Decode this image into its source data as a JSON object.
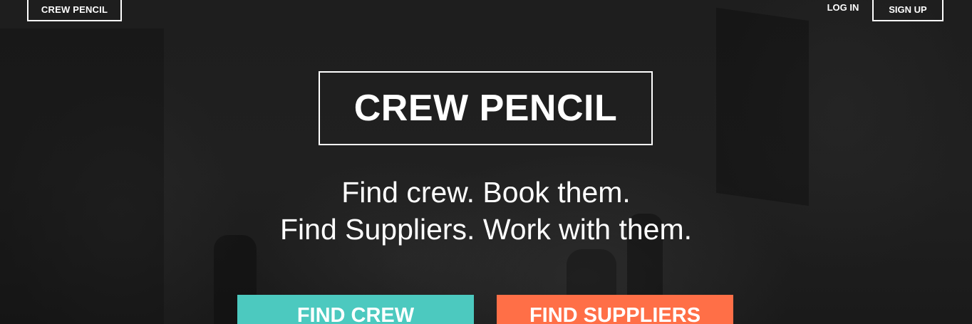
{
  "nav": {
    "logo_label": "CREW PENCIL",
    "login_label": "LOG IN",
    "signup_label": "SIGN UP"
  },
  "hero": {
    "brand_title": "CREW PENCIL",
    "tagline_line1": "Find crew. Book them.",
    "tagline_line2": "Find Suppliers. Work with them.",
    "cta_crew_label": "FIND CREW",
    "cta_suppliers_label": "FIND SUPPLIERS"
  },
  "colors": {
    "background": "#1c1c1c",
    "text": "#ffffff",
    "crew_accent": "#4cc9bf",
    "suppliers_accent": "#ff6f47"
  }
}
